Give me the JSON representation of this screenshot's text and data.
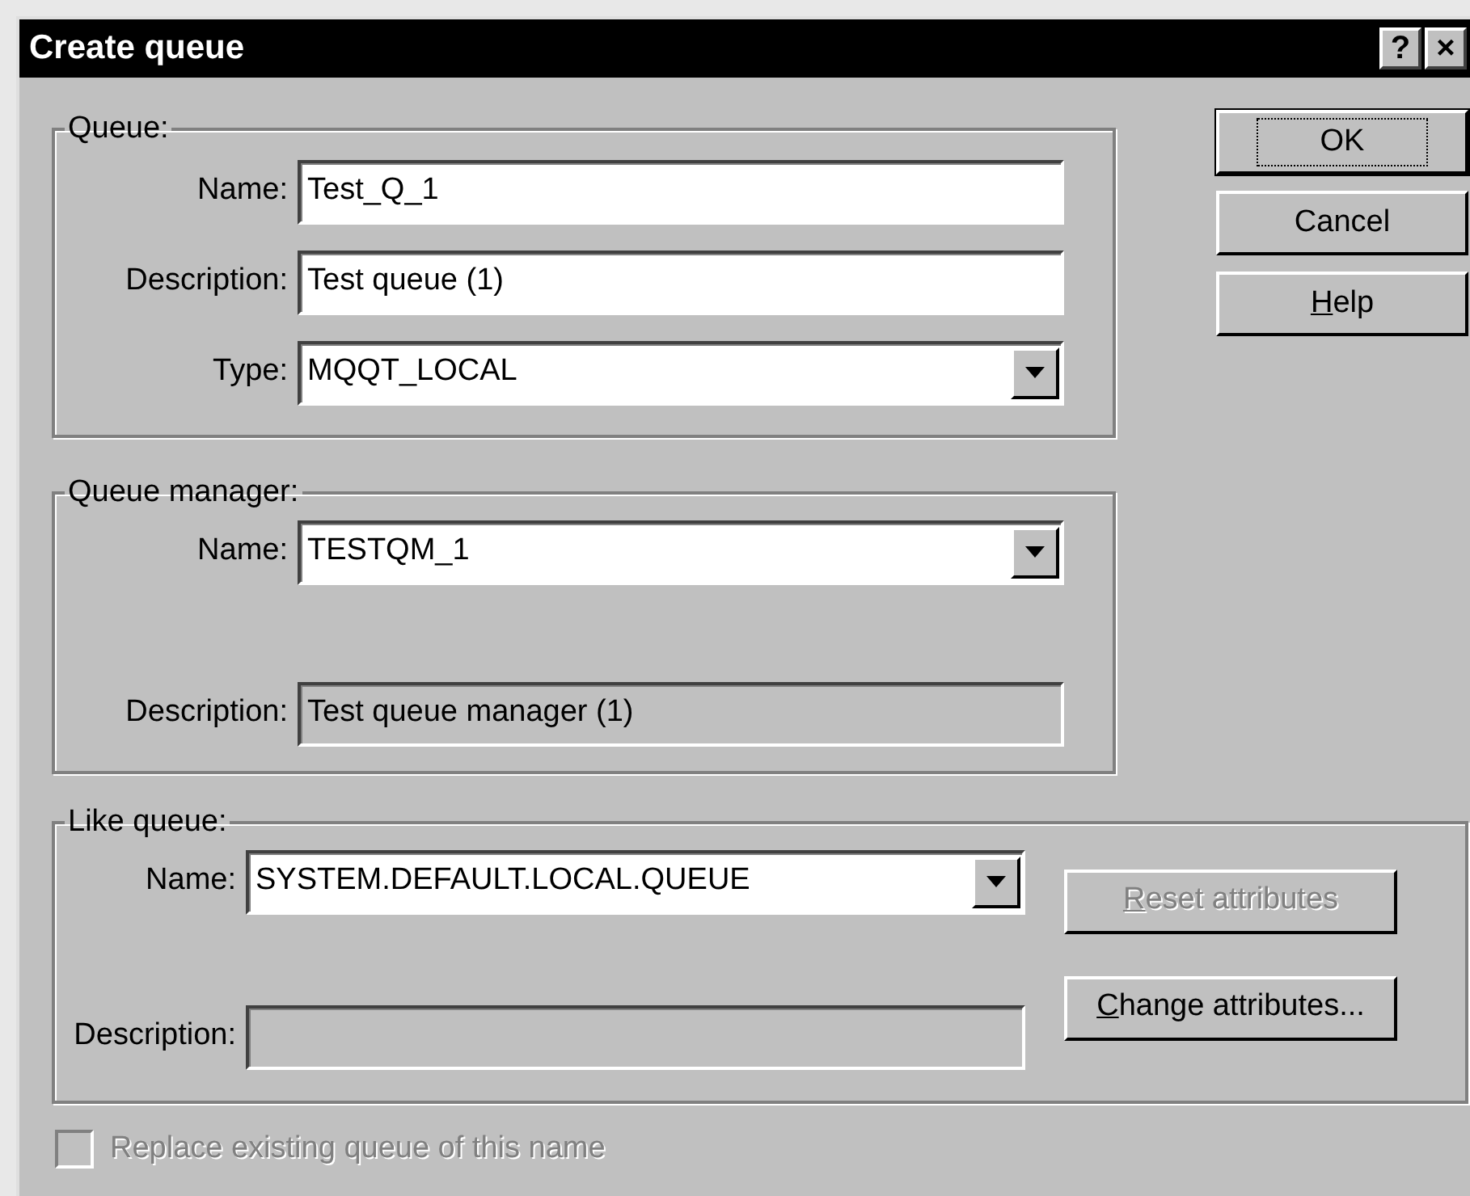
{
  "window": {
    "title": "Create queue",
    "title_buttons": [
      "?",
      "×"
    ]
  },
  "groups": [
    {
      "label": "Queue:",
      "fields": [
        {
          "label": "Name:",
          "kind": "text",
          "value": "Test_Q_1"
        },
        {
          "label": "Description:",
          "kind": "text",
          "value": "Test queue (1)"
        },
        {
          "label": "Type:",
          "kind": "combo",
          "value": "MQQT_LOCAL"
        }
      ]
    },
    {
      "label": "Queue manager:",
      "fields": [
        {
          "label": "Name:",
          "kind": "combo",
          "value": "TESTQM_1"
        },
        {
          "label": "Description:",
          "kind": "readonly",
          "value": "Test queue manager (1)"
        }
      ]
    }
  ],
  "buttons": [
    {
      "label": "OK",
      "default": true,
      "disabled": false,
      "underline_first": false
    },
    {
      "label": "Cancel",
      "default": false,
      "disabled": false,
      "underline_first": false
    },
    {
      "label": "Help",
      "default": false,
      "disabled": false,
      "underline_first": true
    }
  ],
  "like_queue": {
    "label": "Like queue:",
    "fields": [
      {
        "label": "Name:",
        "kind": "combo",
        "value": "SYSTEM.DEFAULT.LOCAL.QUEUE"
      },
      {
        "label": "Description:",
        "kind": "readonly"
      }
    ],
    "buttons": [
      {
        "label": "Reset attributes",
        "default": false,
        "disabled": true,
        "underline_first": true
      },
      {
        "label": "Change attributes...",
        "default": false,
        "disabled": false,
        "underline_first": true
      }
    ]
  },
  "checkbox": {
    "label": "Replace existing queue of this name",
    "checked": false,
    "disabled": true
  }
}
